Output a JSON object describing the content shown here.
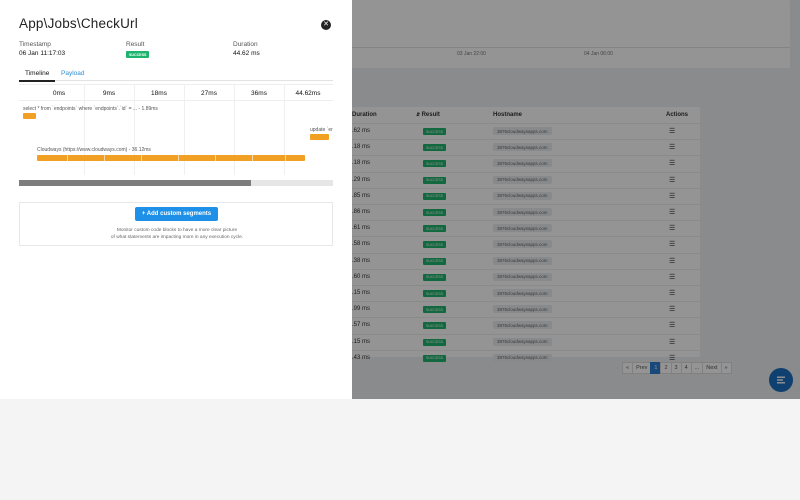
{
  "background": {
    "chart_axis": {
      "labels": [
        "",
        "03 Jan 22:00",
        "04 Jan 06:00"
      ]
    },
    "table": {
      "headers": {
        "duration": "Duration",
        "result": "Result",
        "hostname": "Hostname",
        "actions": "Actions"
      },
      "rows": [
        {
          "duration": ".62 ms",
          "result": "SUCCESS",
          "hostname": "3876cloudwaysapps.com"
        },
        {
          "duration": ".18 ms",
          "result": "SUCCESS",
          "hostname": "3876cloudwaysapps.com"
        },
        {
          "duration": ".18 ms",
          "result": "SUCCESS",
          "hostname": "3876cloudwaysapps.com"
        },
        {
          "duration": ".29 ms",
          "result": "SUCCESS",
          "hostname": "3876cloudwaysapps.com"
        },
        {
          "duration": ".85 ms",
          "result": "SUCCESS",
          "hostname": "3876cloudwaysapps.com"
        },
        {
          "duration": ".86 ms",
          "result": "SUCCESS",
          "hostname": "3876cloudwaysapps.com"
        },
        {
          "duration": ".61 ms",
          "result": "SUCCESS",
          "hostname": "3876cloudwaysapps.com"
        },
        {
          "duration": ".58 ms",
          "result": "SUCCESS",
          "hostname": "3876cloudwaysapps.com"
        },
        {
          "duration": ".38 ms",
          "result": "SUCCESS",
          "hostname": "3876cloudwaysapps.com"
        },
        {
          "duration": ".60 ms",
          "result": "SUCCESS",
          "hostname": "3876cloudwaysapps.com"
        },
        {
          "duration": ".15 ms",
          "result": "SUCCESS",
          "hostname": "3876cloudwaysapps.com"
        },
        {
          "duration": ".99 ms",
          "result": "SUCCESS",
          "hostname": "3876cloudwaysapps.com"
        },
        {
          "duration": ".57 ms",
          "result": "SUCCESS",
          "hostname": "3876cloudwaysapps.com"
        },
        {
          "duration": ".15 ms",
          "result": "SUCCESS",
          "hostname": "3876cloudwaysapps.com"
        },
        {
          "duration": ".43 ms",
          "result": "SUCCESS",
          "hostname": "3876cloudwaysapps.com"
        }
      ]
    },
    "pagination": [
      "Prev",
      "1",
      "2",
      "3",
      "4",
      "...",
      "Next",
      "»"
    ],
    "pagination_prefix": "«"
  },
  "drawer": {
    "title": "App\\Jobs\\CheckUrl",
    "meta": {
      "timestamp_label": "Timestamp",
      "timestamp_value": "06 Jan 11:17:03",
      "result_label": "Result",
      "result_value": "SUCCESS",
      "duration_label": "Duration",
      "duration_value": "44.62 ms"
    },
    "tabs": {
      "timeline": "Timeline",
      "payload": "Payload"
    },
    "timeline_scale": [
      "0ms",
      "9ms",
      "18ms",
      "27ms",
      "36ms",
      "44.62ms"
    ],
    "segments": [
      {
        "label": "select * from `endpoints` where `endpoints`.`id` = ... - 1.89ms"
      },
      {
        "label": "update `er"
      },
      {
        "label": "Cloudways (https://www.cloudways.com) - 36.12ms"
      }
    ],
    "scroll_fraction": 0.74,
    "custom": {
      "button_label": "+ Add custom segments",
      "hint_line1": "Monitor custom code blocks to have a more clear picture",
      "hint_line2": "of what statements are impacting more in any execution cycle."
    }
  },
  "colors": {
    "accent": "#1e90e8",
    "success": "#1fb46d",
    "segment": "#f2a024"
  }
}
